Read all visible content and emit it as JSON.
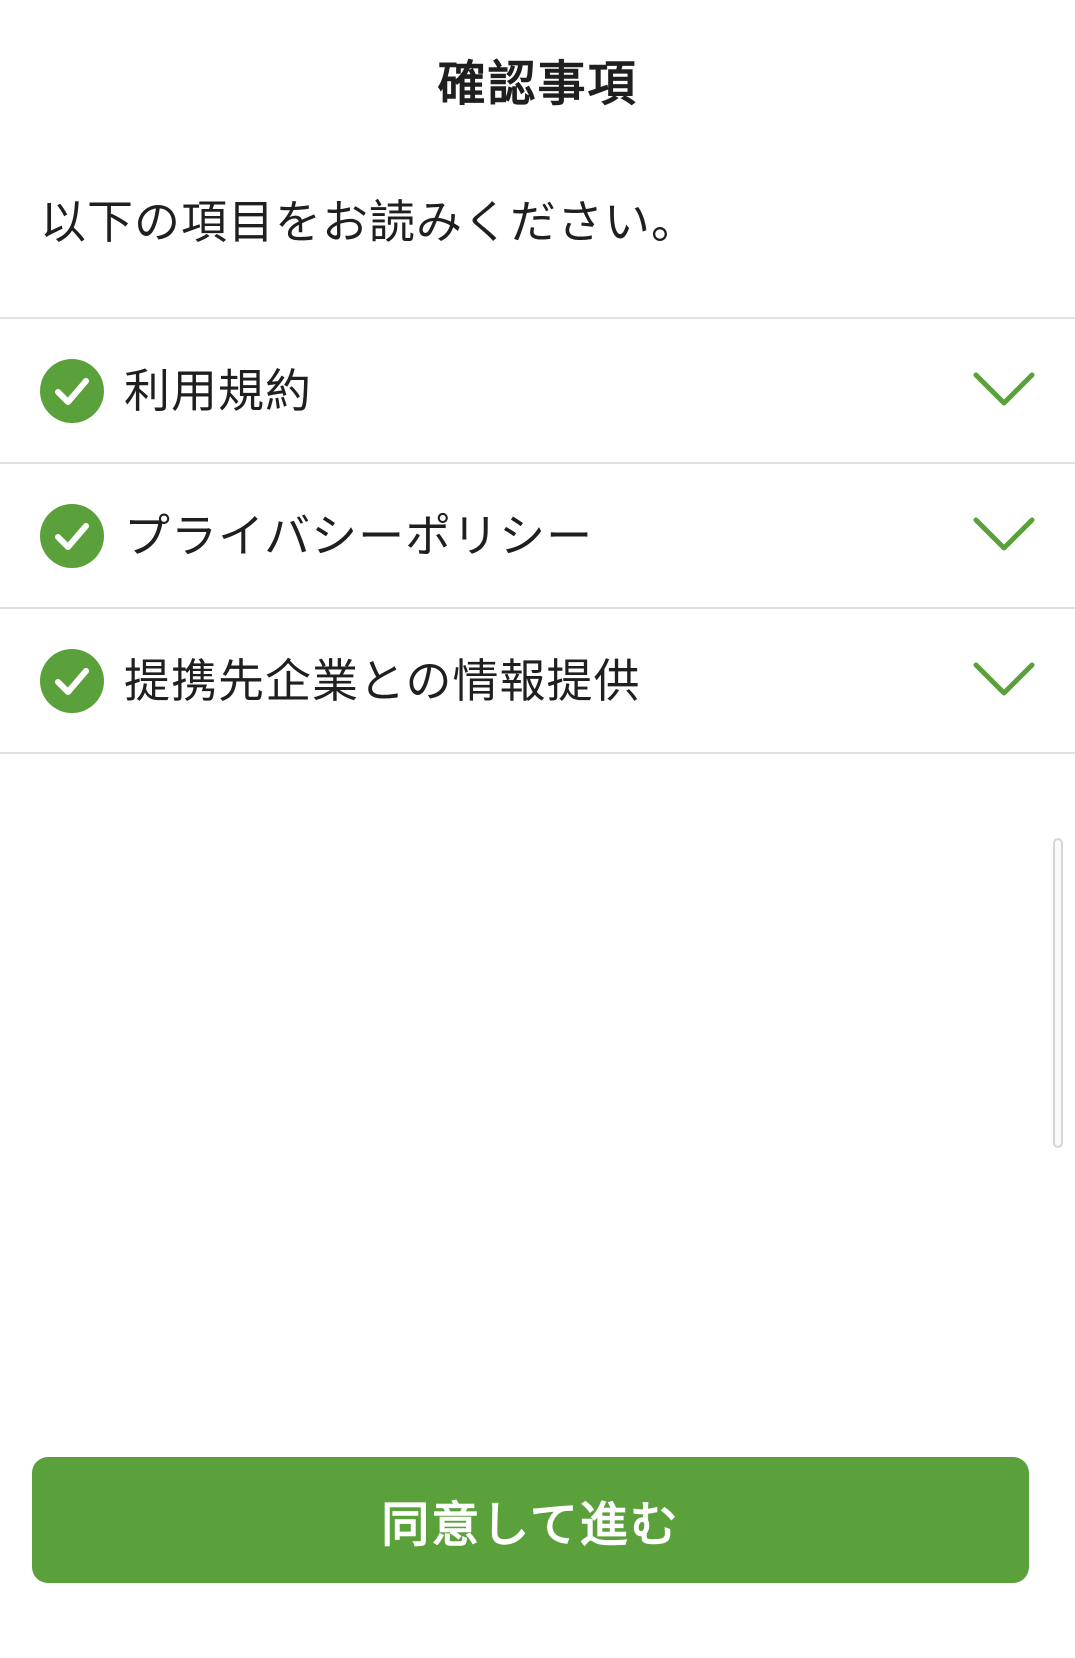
{
  "header": {
    "title": "確認事項"
  },
  "intro_text": "以下の項目をお読みください。",
  "items": [
    {
      "label": "利用規約",
      "checked": true,
      "icon": "check-circle-icon",
      "expand_icon": "chevron-down-icon"
    },
    {
      "label": "プライバシーポリシー",
      "checked": true,
      "icon": "check-circle-icon",
      "expand_icon": "chevron-down-icon"
    },
    {
      "label": "提携先企業との情報提供",
      "checked": true,
      "icon": "check-circle-icon",
      "expand_icon": "chevron-down-icon"
    }
  ],
  "agree_button": {
    "label": "同意して進む"
  },
  "colors": {
    "accent": "#5ba13b",
    "divider": "#e0e0e0",
    "text": "#1f1f1f",
    "background": "#ffffff"
  }
}
